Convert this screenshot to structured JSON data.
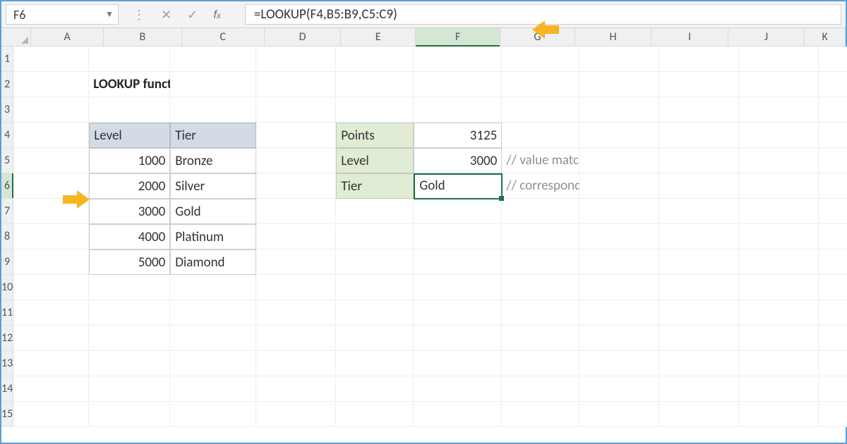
{
  "namebox": {
    "value": "F6"
  },
  "formula_bar": {
    "formula": "=LOOKUP(F4,B5:B9,C5:C9)"
  },
  "columns": [
    "A",
    "B",
    "C",
    "D",
    "E",
    "F",
    "G",
    "H",
    "I",
    "J",
    "K"
  ],
  "active_col": "F",
  "rows": [
    1,
    2,
    3,
    4,
    5,
    6,
    7,
    8,
    9,
    10,
    11,
    12,
    13,
    14,
    15
  ],
  "active_row": 6,
  "title": "LOOKUP function",
  "table": {
    "headers": {
      "level": "Level",
      "tier": "Tier"
    },
    "rows": [
      {
        "level": 1000,
        "tier": "Bronze"
      },
      {
        "level": 2000,
        "tier": "Silver"
      },
      {
        "level": 3000,
        "tier": "Gold"
      },
      {
        "level": 4000,
        "tier": "Platinum"
      },
      {
        "level": 5000,
        "tier": "Diamond"
      }
    ]
  },
  "result": {
    "points_label": "Points",
    "points_value": 3125,
    "level_label": "Level",
    "level_value": 3000,
    "tier_label": "Tier",
    "tier_value": "Gold"
  },
  "comments": {
    "c1": "// value matched in level",
    "c2": "// corresponding value in tier"
  },
  "chart_data": {
    "type": "table",
    "title": "LOOKUP function example",
    "lookup_table": {
      "columns": [
        "Level",
        "Tier"
      ],
      "rows": [
        [
          1000,
          "Bronze"
        ],
        [
          2000,
          "Silver"
        ],
        [
          3000,
          "Gold"
        ],
        [
          4000,
          "Platinum"
        ],
        [
          5000,
          "Diamond"
        ]
      ]
    },
    "lookup": {
      "input_points": 3125,
      "matched_level": 3000,
      "matched_tier": "Gold"
    },
    "formula": "=LOOKUP(F4,B5:B9,C5:C9)",
    "active_cell": "F6"
  }
}
